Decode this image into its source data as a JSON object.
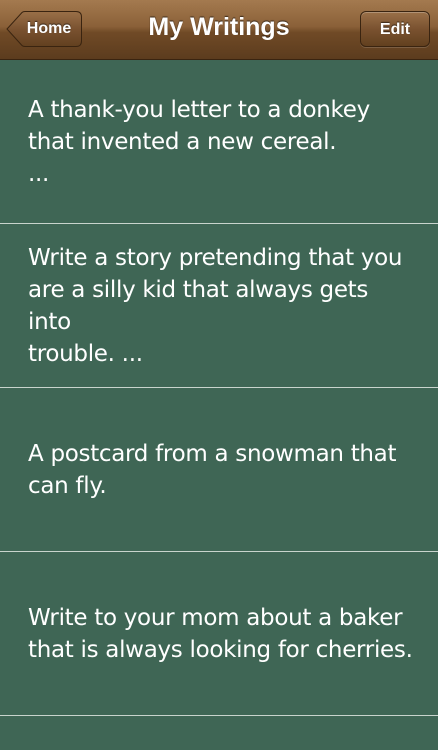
{
  "navbar": {
    "title": "My Writings",
    "back_label": "Home",
    "edit_label": "Edit"
  },
  "writings": [
    {
      "text": "A thank-you letter to a donkey\nthat invented a new cereal.\n..."
    },
    {
      "text": "Write a story pretending that you\nare a silly kid that always gets into\ntrouble. ..."
    },
    {
      "text": "A postcard from a snowman that\ncan fly."
    },
    {
      "text": "Write to your mom about a baker\nthat is always looking for cherries."
    }
  ]
}
